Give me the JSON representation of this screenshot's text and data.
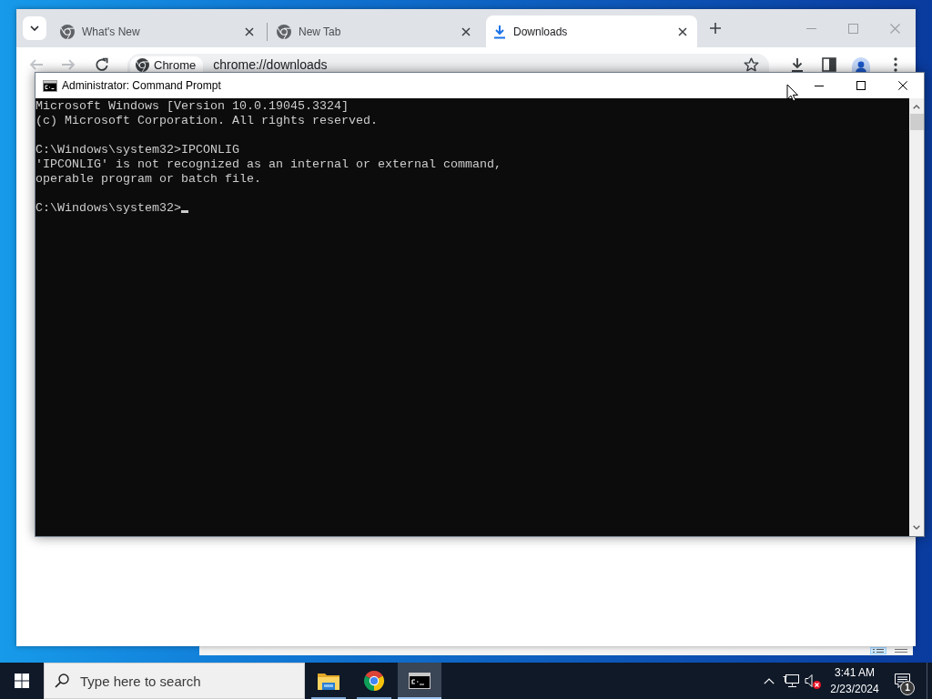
{
  "browser": {
    "tabs": [
      {
        "title": "What's New",
        "kind": "web",
        "selected": false
      },
      {
        "title": "New Tab",
        "kind": "web",
        "selected": false
      },
      {
        "title": "Downloads",
        "kind": "downloads",
        "selected": true
      }
    ],
    "toolbar": {
      "back": {
        "disabled": true
      },
      "forward": {
        "disabled": true
      },
      "site_chip": "Chrome",
      "url": "chrome://downloads"
    }
  },
  "console_window": {
    "title": "Administrator: Command Prompt",
    "blocks": [
      [
        "Microsoft Windows [Version 10.0.19045.3324]",
        "(c) Microsoft Corporation. All rights reserved."
      ],
      [
        "C:\\Windows\\system32>IPCONLIG",
        "'IPCONLIG' is not recognized as an internal or external command,",
        "operable program or batch file."
      ]
    ],
    "prompt": "C:\\Windows\\system32>",
    "cursor": true
  },
  "taskbar": {
    "search": {
      "placeholder": "Type here to search"
    },
    "apps": [
      {
        "kind": "file-explorer",
        "running": true,
        "selected": false
      },
      {
        "kind": "chrome",
        "running": true,
        "selected": false
      },
      {
        "kind": "console",
        "running": true,
        "selected": true
      }
    ],
    "tray": {
      "volume_muted": true,
      "time": "3:41 AM",
      "date": "2/23/2024",
      "notifications": "1"
    }
  }
}
